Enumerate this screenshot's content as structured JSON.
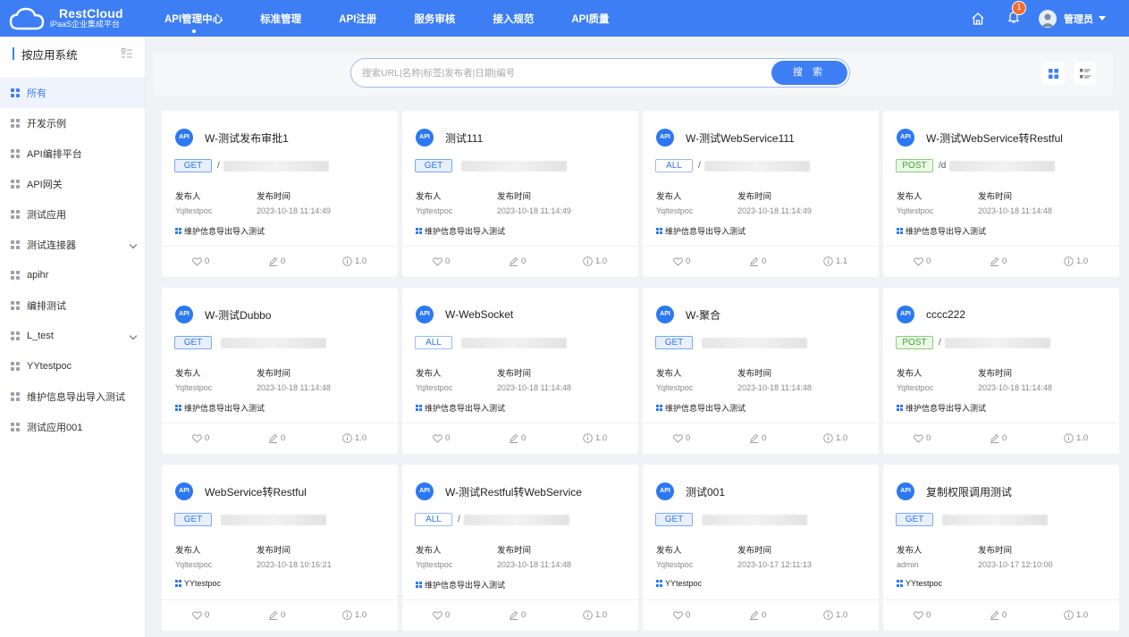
{
  "app": {
    "name": "RestCloud",
    "subtitle": "iPaaS企业集成平台"
  },
  "nav": [
    {
      "label": "API管理中心",
      "active": true
    },
    {
      "label": "标准管理"
    },
    {
      "label": "API注册"
    },
    {
      "label": "服务审核"
    },
    {
      "label": "接入规范"
    },
    {
      "label": "API质量"
    }
  ],
  "header": {
    "notification_count": "1",
    "user_name": "管理员"
  },
  "sidebar": {
    "title": "按应用系统",
    "items": [
      {
        "label": "所有",
        "active": true
      },
      {
        "label": "开发示例"
      },
      {
        "label": "API编排平台"
      },
      {
        "label": "API网关"
      },
      {
        "label": "测试应用"
      },
      {
        "label": "测试连接器",
        "expandable": true
      },
      {
        "label": "apihr"
      },
      {
        "label": "编排测试"
      },
      {
        "label": "L_test",
        "expandable": true
      },
      {
        "label": "YYtestpoc"
      },
      {
        "label": "维护信息导出导入测试"
      },
      {
        "label": "测试应用001"
      }
    ]
  },
  "search": {
    "placeholder": "搜索URL|名称|标签|发布者|日期|编号",
    "button_label": "搜 索"
  },
  "labels": {
    "publisher": "发布人",
    "publish_time": "发布时间",
    "api_badge": "API"
  },
  "cards": [
    {
      "title": "W-测试发布审批1",
      "method": "GET",
      "path": "/",
      "publisher": "Yqltestpoc",
      "time": "2023-10-18 11:14:49",
      "tag": "维护信息导出导入测试",
      "likes": "0",
      "edits": "0",
      "version": "1.0"
    },
    {
      "title": "测试111",
      "method": "GET",
      "path": "",
      "publisher": "Yqltestpoc",
      "time": "2023-10-18 11:14:49",
      "tag": "维护信息导出导入测试",
      "likes": "0",
      "edits": "0",
      "version": "1.0"
    },
    {
      "title": "W-测试WebService111",
      "method": "ALL",
      "path": "/",
      "publisher": "Yqltestpoc",
      "time": "2023-10-18 11:14:49",
      "tag": "维护信息导出导入测试",
      "likes": "0",
      "edits": "0",
      "version": "1.1"
    },
    {
      "title": "W-测试WebService转Restful",
      "method": "POST",
      "path": "/d",
      "publisher": "Yqltestpoc",
      "time": "2023-10-18 11:14:48",
      "tag": "维护信息导出导入测试",
      "likes": "0",
      "edits": "0",
      "version": "1.0"
    },
    {
      "title": "W-测试Dubbo",
      "method": "GET",
      "path": "",
      "publisher": "Yqltestpoc",
      "time": "2023-10-18 11:14:48",
      "tag": "维护信息导出导入测试",
      "likes": "0",
      "edits": "0",
      "version": "1.0"
    },
    {
      "title": "W-WebSocket",
      "method": "ALL",
      "path": "",
      "publisher": "Yqltestpoc",
      "time": "2023-10-18 11:14:48",
      "tag": "维护信息导出导入测试",
      "likes": "0",
      "edits": "0",
      "version": "1.0"
    },
    {
      "title": "W-聚合",
      "method": "GET",
      "path": "",
      "publisher": "Yqltestpoc",
      "time": "2023-10-18 11:14:48",
      "tag": "维护信息导出导入测试",
      "likes": "0",
      "edits": "0",
      "version": "1.0"
    },
    {
      "title": "cccc222",
      "method": "POST",
      "path": "/",
      "publisher": "Yqltestpoc",
      "time": "2023-10-18 11:14:48",
      "tag": "维护信息导出导入测试",
      "likes": "0",
      "edits": "0",
      "version": "1.0"
    },
    {
      "title": "WebService转Restful",
      "method": "GET",
      "path": "",
      "publisher": "Yqltestpoc",
      "time": "2023-10-18 10:16:21",
      "tag": "YYtestpoc",
      "likes": "0",
      "edits": "0",
      "version": "1.0"
    },
    {
      "title": "W-测试Restful转WebService",
      "method": "ALL",
      "path": "/",
      "publisher": "Yqltestpoc",
      "time": "2023-10-18 11:14:48",
      "tag": "维护信息导出导入测试",
      "likes": "0",
      "edits": "0",
      "version": "1.0"
    },
    {
      "title": "测试001",
      "method": "GET",
      "path": "",
      "publisher": "Yqltestpoc",
      "time": "2023-10-17 12:11:13",
      "tag": "YYtestpoc",
      "likes": "0",
      "edits": "0",
      "version": "1.0"
    },
    {
      "title": "复制权限调用测试",
      "method": "GET",
      "path": "",
      "publisher": "admin",
      "time": "2023-10-17 12:10:00",
      "tag": "YYtestpoc",
      "likes": "0",
      "edits": "0",
      "version": "1.0"
    }
  ],
  "colors": {
    "brand": "#3d7ef5",
    "get": "#2b78f2",
    "post": "#3aa43a",
    "badge": "#f56c2d"
  }
}
